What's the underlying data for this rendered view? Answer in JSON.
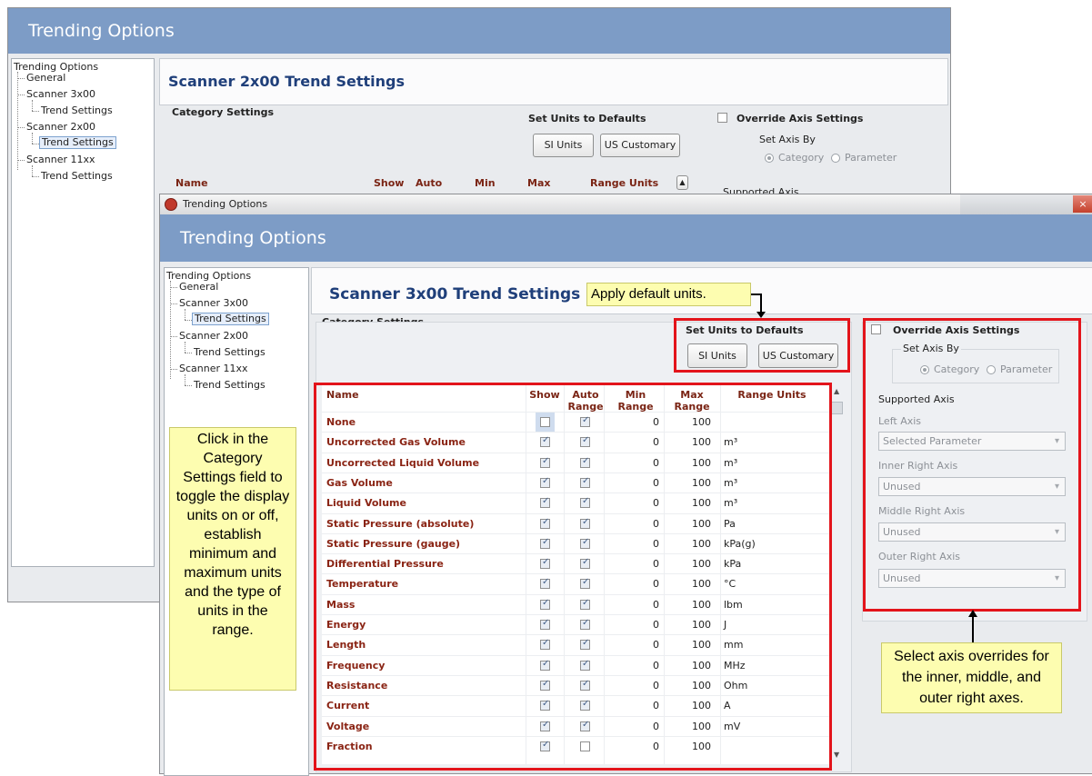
{
  "back_window": {
    "header": "Trending Options",
    "tree": [
      "Trending Options",
      "General",
      "Scanner 3x00",
      "Trend Settings",
      "Scanner 2x00",
      "Trend Settings",
      "Scanner 11xx",
      "Trend Settings"
    ],
    "page_title": "Scanner 2x00 Trend Settings",
    "category_settings_label": "Category Settings",
    "set_units_label": "Set Units to Defaults",
    "si_button": "SI Units",
    "us_button": "US Customary",
    "override_label": "Override Axis Settings",
    "set_axis_by_label": "Set Axis By",
    "radio_category": "Category",
    "radio_parameter": "Parameter",
    "supported_axis_label": "Supported Axis",
    "columns": [
      "Name",
      "Show",
      "Auto",
      "Min",
      "Max",
      "Range Units"
    ]
  },
  "front_window": {
    "title_bar": "Trending Options",
    "header": "Trending Options",
    "tree": [
      "Trending Options",
      "General",
      "Scanner 3x00",
      "Trend Settings",
      "Scanner 2x00",
      "Trend Settings",
      "Scanner 11xx",
      "Trend Settings"
    ],
    "page_title": "Scanner 3x00 Trend Settings",
    "category_settings_label": "Category Settings",
    "set_units_label": "Set Units to Defaults",
    "si_button": "SI Units",
    "us_button": "US Customary",
    "override_label": "Override Axis Settings",
    "set_axis_by_label": "Set Axis By",
    "radio_category": "Category",
    "radio_parameter": "Parameter",
    "supported_axis_label": "Supported Axis",
    "left_axis_label": "Left Axis",
    "left_axis_value": "Selected Parameter",
    "inner_right_label": "Inner Right Axis",
    "inner_right_value": "Unused",
    "middle_right_label": "Middle Right Axis",
    "middle_right_value": "Unused",
    "outer_right_label": "Outer Right Axis",
    "outer_right_value": "Unused",
    "columns": {
      "name": "Name",
      "show": "Show",
      "auto_1": "Auto",
      "auto_2": "Range",
      "min_1": "Min",
      "min_2": "Range",
      "max_1": "Max",
      "max_2": "Range",
      "units": "Range Units"
    },
    "rows": [
      {
        "name": "None",
        "show": false,
        "auto": true,
        "min": "0",
        "max": "100",
        "units": ""
      },
      {
        "name": "Uncorrected Gas Volume",
        "show": true,
        "auto": true,
        "min": "0",
        "max": "100",
        "units": "m³"
      },
      {
        "name": "Uncorrected Liquid Volume",
        "show": true,
        "auto": true,
        "min": "0",
        "max": "100",
        "units": "m³"
      },
      {
        "name": "Gas Volume",
        "show": true,
        "auto": true,
        "min": "0",
        "max": "100",
        "units": "m³"
      },
      {
        "name": "Liquid Volume",
        "show": true,
        "auto": true,
        "min": "0",
        "max": "100",
        "units": "m³"
      },
      {
        "name": "Static Pressure (absolute)",
        "show": true,
        "auto": true,
        "min": "0",
        "max": "100",
        "units": "Pa"
      },
      {
        "name": "Static Pressure (gauge)",
        "show": true,
        "auto": true,
        "min": "0",
        "max": "100",
        "units": "kPa(g)"
      },
      {
        "name": "Differential Pressure",
        "show": true,
        "auto": true,
        "min": "0",
        "max": "100",
        "units": "kPa"
      },
      {
        "name": "Temperature",
        "show": true,
        "auto": true,
        "min": "0",
        "max": "100",
        "units": "°C"
      },
      {
        "name": "Mass",
        "show": true,
        "auto": true,
        "min": "0",
        "max": "100",
        "units": "lbm"
      },
      {
        "name": "Energy",
        "show": true,
        "auto": true,
        "min": "0",
        "max": "100",
        "units": "J"
      },
      {
        "name": "Length",
        "show": true,
        "auto": true,
        "min": "0",
        "max": "100",
        "units": "mm"
      },
      {
        "name": "Frequency",
        "show": true,
        "auto": true,
        "min": "0",
        "max": "100",
        "units": "MHz"
      },
      {
        "name": "Resistance",
        "show": true,
        "auto": true,
        "min": "0",
        "max": "100",
        "units": "Ohm"
      },
      {
        "name": "Current",
        "show": true,
        "auto": true,
        "min": "0",
        "max": "100",
        "units": "A"
      },
      {
        "name": "Voltage",
        "show": true,
        "auto": true,
        "min": "0",
        "max": "100",
        "units": "mV"
      },
      {
        "name": "Fraction",
        "show": true,
        "auto": false,
        "min": "0",
        "max": "100",
        "units": ""
      }
    ]
  },
  "callouts": {
    "apply_default": "Apply default units.",
    "category_help": "Click in the Category Settings field to toggle the display units on or off, establish minimum and maximum units and the type of units in the range.",
    "axis_help": "Select axis overrides for the inner, middle, and outer right axes."
  },
  "colors": {
    "header_band": "#7d9cc6",
    "title_blue": "#1f3f7a",
    "name_red": "#8a2414",
    "highlight_red": "#e3141b",
    "callout_yellow": "#fdfdb0"
  }
}
